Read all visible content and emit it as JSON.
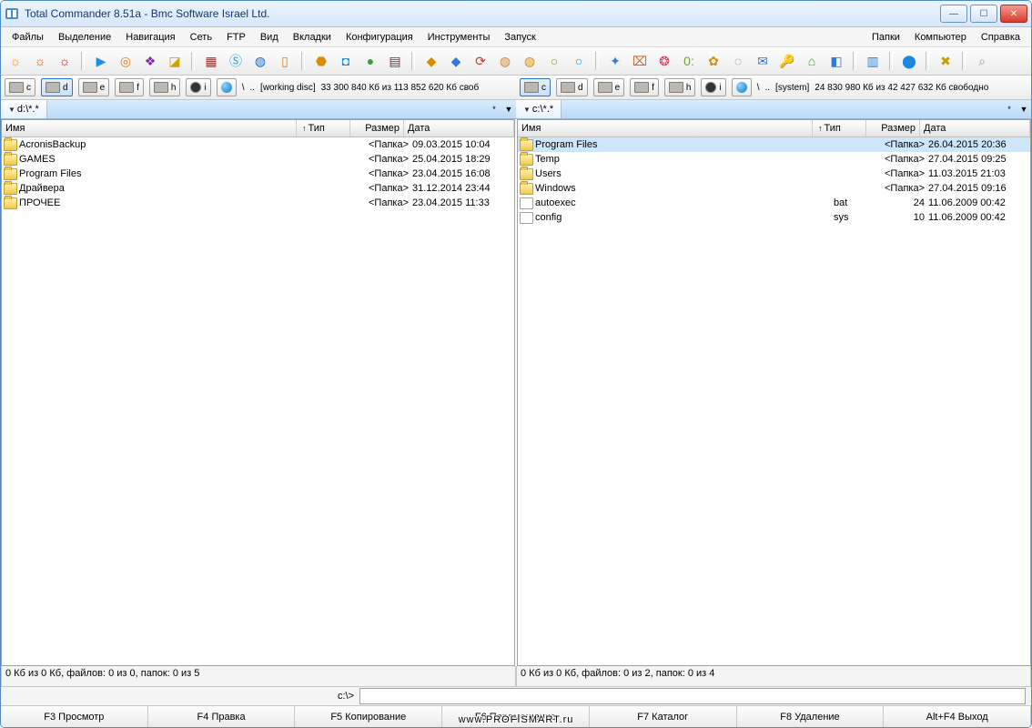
{
  "title": "Total Commander 8.51a - Bmc Software Israel Ltd.",
  "menu": {
    "left": [
      "Файлы",
      "Выделение",
      "Навигация",
      "Сеть",
      "FTP",
      "Вид",
      "Вкладки",
      "Конфигурация",
      "Инструменты",
      "Запуск"
    ],
    "right": [
      "Папки",
      "Компьютер",
      "Справка"
    ]
  },
  "toolbar": [
    {
      "icon": "☼",
      "color": "#f08a1d",
      "name": "tool-1"
    },
    {
      "icon": "☼",
      "color": "#e05b00",
      "name": "tool-2"
    },
    {
      "icon": "☼",
      "color": "#b02c17",
      "name": "tool-3"
    },
    {
      "sep": true
    },
    {
      "icon": "▶",
      "color": "#1d8fe0",
      "name": "tool-play"
    },
    {
      "icon": "◎",
      "color": "#e07e1d",
      "name": "tool-target"
    },
    {
      "icon": "❖",
      "color": "#7c2aa8",
      "name": "tool-diamond"
    },
    {
      "icon": "◪",
      "color": "#cfa400",
      "name": "tool-pdf"
    },
    {
      "sep": true
    },
    {
      "icon": "▦",
      "color": "#d32020",
      "name": "tool-grid"
    },
    {
      "icon": "Ⓢ",
      "color": "#00aff0",
      "name": "tool-skype"
    },
    {
      "icon": "◍",
      "color": "#1467c8",
      "name": "tool-globe"
    },
    {
      "icon": "▯",
      "color": "#e07e1d",
      "name": "tool-doc"
    },
    {
      "sep": true
    },
    {
      "icon": "⬣",
      "color": "#d88c00",
      "name": "tool-hex"
    },
    {
      "icon": "◘",
      "color": "#1c88e4",
      "name": "tool-tv"
    },
    {
      "icon": "●",
      "color": "#3aa13a",
      "name": "tool-ut"
    },
    {
      "icon": "▤",
      "color": "#8a2222",
      "name": "tool-fz"
    },
    {
      "sep": true
    },
    {
      "icon": "◆",
      "color": "#d88c00",
      "name": "tool-shield1"
    },
    {
      "icon": "◆",
      "color": "#3477d6",
      "name": "tool-shield2"
    },
    {
      "icon": "⟳",
      "color": "#c9342c",
      "name": "tool-refresh"
    },
    {
      "icon": "◍",
      "color": "#d1862b",
      "name": "tool-disc"
    },
    {
      "icon": "◍",
      "color": "#d88c00",
      "name": "tool-disc2"
    },
    {
      "icon": "○",
      "color": "#6da722",
      "name": "tool-ring1"
    },
    {
      "icon": "○",
      "color": "#1c88e4",
      "name": "tool-ring2"
    },
    {
      "sep": true
    },
    {
      "icon": "✦",
      "color": "#3477d6",
      "name": "tool-wand"
    },
    {
      "icon": "⌧",
      "color": "#c9692c",
      "name": "tool-stamp"
    },
    {
      "icon": "❂",
      "color": "#d6334e",
      "name": "tool-bug"
    },
    {
      "icon": "0:",
      "color": "#6da722",
      "name": "tool-clock"
    },
    {
      "icon": "✿",
      "color": "#d88c00",
      "name": "tool-flower"
    },
    {
      "icon": "◌",
      "color": "#777",
      "name": "tool-empty"
    },
    {
      "icon": "✉",
      "color": "#3477d6",
      "name": "tool-mail"
    },
    {
      "icon": "🔑",
      "color": "#c9a227",
      "name": "tool-key"
    },
    {
      "icon": "⌂",
      "color": "#3aa13a",
      "name": "tool-home"
    },
    {
      "icon": "◧",
      "color": "#3477d6",
      "name": "tool-panel"
    },
    {
      "sep": true
    },
    {
      "icon": "▥",
      "color": "#1c88e4",
      "name": "tool-cols"
    },
    {
      "sep": true
    },
    {
      "icon": "⬤",
      "color": "#1c88e4",
      "name": "tool-ball"
    },
    {
      "sep": true
    },
    {
      "icon": "✖",
      "color": "#c9a000",
      "name": "tool-x"
    },
    {
      "sep": true
    },
    {
      "icon": "⌕",
      "color": "#999",
      "name": "tool-search"
    }
  ],
  "drives_common": [
    {
      "label": "c",
      "kind": "hdd"
    },
    {
      "label": "d",
      "kind": "hdd"
    },
    {
      "label": "e",
      "kind": "hdd"
    },
    {
      "label": "f",
      "kind": "hdd"
    },
    {
      "label": "h",
      "kind": "hdd"
    },
    {
      "label": "i",
      "kind": "net"
    },
    {
      "label": "",
      "kind": "web"
    },
    {
      "label": "\\",
      "kind": "txt"
    },
    {
      "label": "..",
      "kind": "txt"
    }
  ],
  "left": {
    "activeDrive": "d",
    "volume": "[working disc]",
    "free": "33 300 840 Кб из 113 852 620 Кб своб",
    "tab": "d:\\*.*",
    "status": "0 Кб из 0 Кб, файлов: 0 из 0, папок: 0 из 5",
    "files": [
      {
        "name": "AcronisBackup",
        "ext": "",
        "size": "<Папка>",
        "date": "09.03.2015 10:04",
        "kind": "folder"
      },
      {
        "name": "GAMES",
        "ext": "",
        "size": "<Папка>",
        "date": "25.04.2015 18:29",
        "kind": "folder"
      },
      {
        "name": "Program Files",
        "ext": "",
        "size": "<Папка>",
        "date": "23.04.2015 16:08",
        "kind": "folder"
      },
      {
        "name": "Драйвера",
        "ext": "",
        "size": "<Папка>",
        "date": "31.12.2014 23:44",
        "kind": "folder"
      },
      {
        "name": "ПРОЧЕЕ",
        "ext": "",
        "size": "<Папка>",
        "date": "23.04.2015 11:33",
        "kind": "folder"
      }
    ]
  },
  "right": {
    "activeDrive": "c",
    "volume": "[system]",
    "free": "24 830 980 Кб из 42 427 632 Кб свободно",
    "tab": "c:\\*.*",
    "status": "0 Кб из 0 Кб, файлов: 0 из 2, папок: 0 из 4",
    "files": [
      {
        "name": "Program Files",
        "ext": "",
        "size": "<Папка>",
        "date": "26.04.2015 20:36",
        "kind": "folder",
        "sel": true
      },
      {
        "name": "Temp",
        "ext": "",
        "size": "<Папка>",
        "date": "27.04.2015 09:25",
        "kind": "folder"
      },
      {
        "name": "Users",
        "ext": "",
        "size": "<Папка>",
        "date": "11.03.2015 21:03",
        "kind": "folder"
      },
      {
        "name": "Windows",
        "ext": "",
        "size": "<Папка>",
        "date": "27.04.2015 09:16",
        "kind": "folder"
      },
      {
        "name": "autoexec",
        "ext": "bat",
        "size": "24",
        "date": "11.06.2009 00:42",
        "kind": "bat"
      },
      {
        "name": "config",
        "ext": "sys",
        "size": "10",
        "date": "11.06.2009 00:42",
        "kind": "file"
      }
    ]
  },
  "headers": {
    "name": "Имя",
    "ext": "Тип",
    "size": "Размер",
    "date": "Дата",
    "sort": "↑"
  },
  "cmd": {
    "prompt": "c:\\>"
  },
  "fkeys": [
    "F3 Просмотр",
    "F4 Правка",
    "F5 Копирование",
    "F6 Перемещение",
    "F7 Каталог",
    "F8 Удаление",
    "Alt+F4 Выход"
  ],
  "watermark": "www.PROFISMART.ru"
}
